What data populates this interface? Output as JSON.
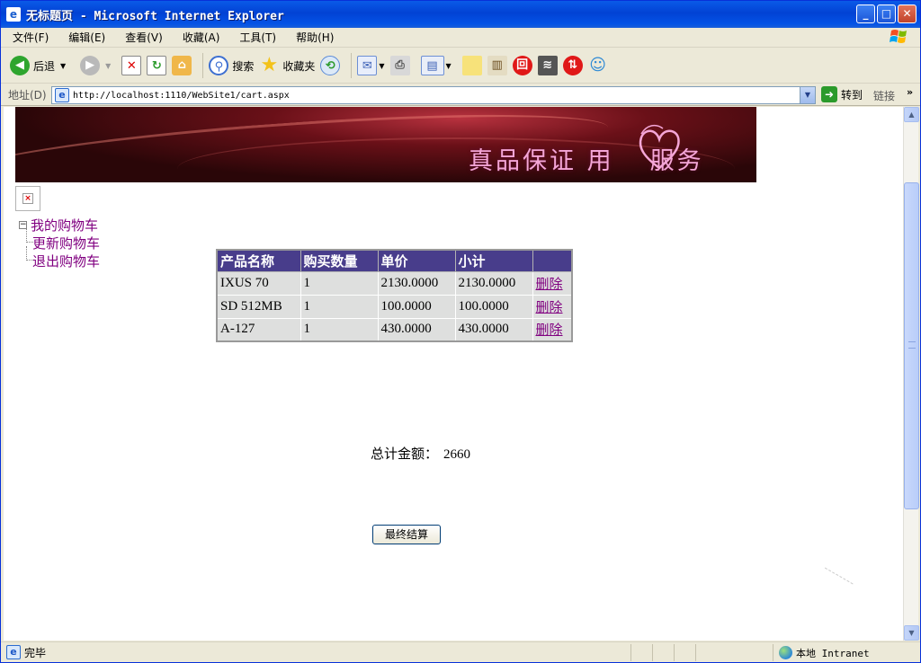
{
  "window": {
    "title": "无标题页 - Microsoft Internet Explorer",
    "app_icon": "ie-icon",
    "controls": [
      "minimize",
      "maximize",
      "close"
    ]
  },
  "menu": [
    "文件(F)",
    "编辑(E)",
    "查看(V)",
    "收藏(A)",
    "工具(T)",
    "帮助(H)"
  ],
  "toolbar": {
    "back_label": "后退",
    "search_label": "搜索",
    "favorites_label": "收藏夹"
  },
  "address": {
    "label": "地址(D)",
    "url": "http://localhost:1110/WebSite1/cart.aspx",
    "go_label": "转到",
    "links_label": "链接"
  },
  "banner": {
    "slogan_left": "真品保证 用",
    "slogan_right": "服务"
  },
  "tree": {
    "root": "我的购物车",
    "children": [
      "更新购物车",
      "退出购物车"
    ]
  },
  "cart": {
    "headers": [
      "产品名称",
      "购买数量",
      "单价",
      "小计",
      ""
    ],
    "rows": [
      {
        "name": "IXUS 70",
        "qty": "1",
        "price": "2130.0000",
        "subtotal": "2130.0000",
        "action": "删除"
      },
      {
        "name": "SD 512MB",
        "qty": "1",
        "price": "100.0000",
        "subtotal": "100.0000",
        "action": "删除"
      },
      {
        "name": "A-127",
        "qty": "1",
        "price": "430.0000",
        "subtotal": "430.0000",
        "action": "删除"
      }
    ]
  },
  "total": {
    "label": "总计金额：",
    "value": "2660"
  },
  "checkout_label": "最终结算",
  "status": {
    "text": "完毕",
    "zone": "本地 Intranet"
  }
}
